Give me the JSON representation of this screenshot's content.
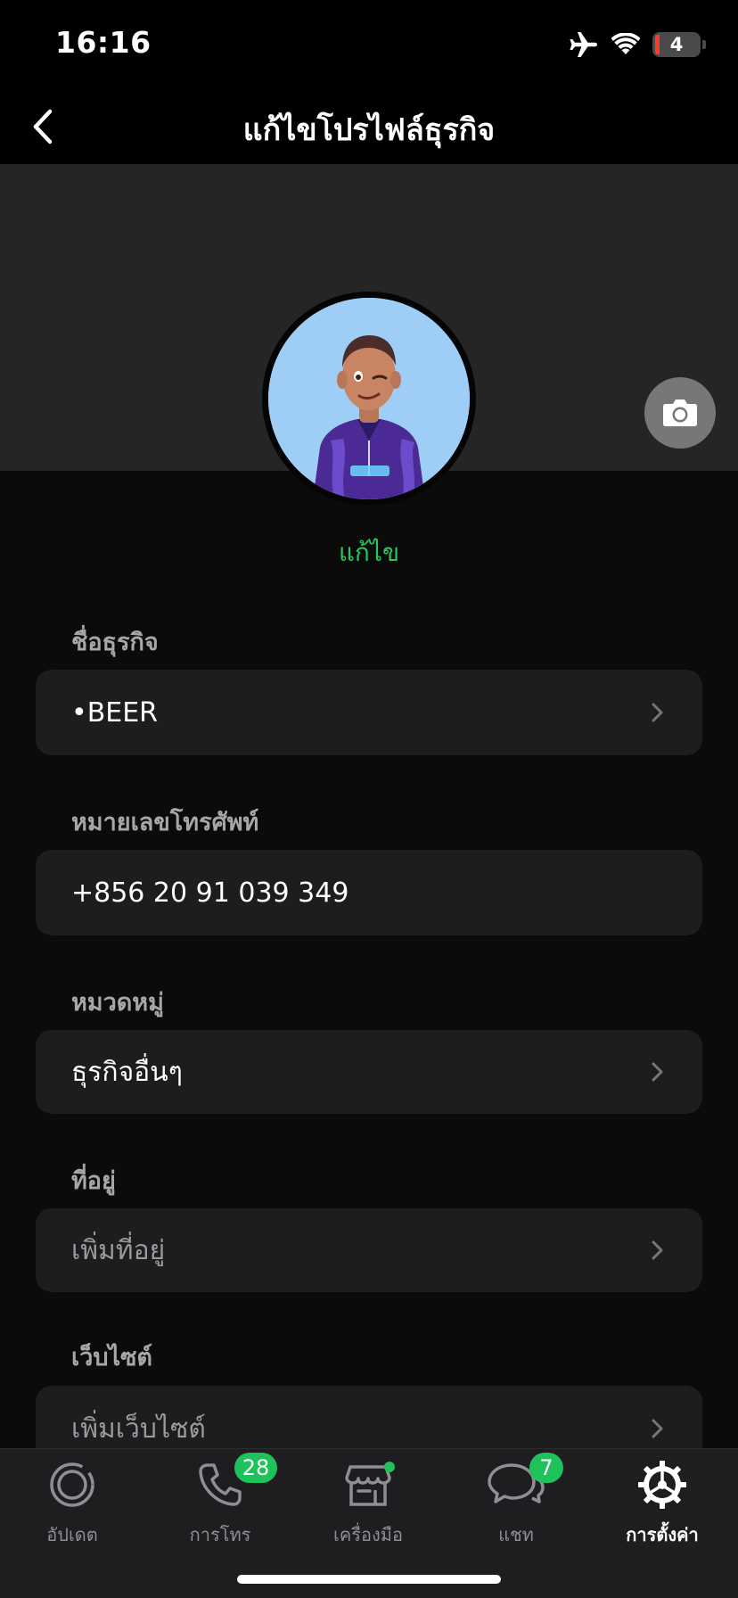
{
  "status_bar": {
    "time": "16:16",
    "battery": "4"
  },
  "header": {
    "title": "แก้ไขโปรไฟล์ธุรกิจ"
  },
  "profile": {
    "edit_label": "แก้ไข"
  },
  "fields": [
    {
      "label": "ชื่อธุรกิจ",
      "value": "•BEER",
      "placeholder": false,
      "chevron": true
    },
    {
      "label": "หมายเลขโทรศัพท์",
      "value": "+856 20 91 039 349",
      "placeholder": false,
      "chevron": false
    },
    {
      "label": "หมวดหมู่",
      "value": "ธุรกิจอื่นๆ",
      "placeholder": false,
      "chevron": true
    },
    {
      "label": "ที่อยู่",
      "value": "เพิ่มที่อยู่",
      "placeholder": true,
      "chevron": true
    },
    {
      "label": "เว็บไซต์",
      "value": "เพิ่มเว็บไซต์",
      "placeholder": true,
      "chevron": true
    }
  ],
  "tabs": [
    {
      "label": "อัปเดต",
      "icon": "updates-icon"
    },
    {
      "label": "การโทร",
      "icon": "phone-icon",
      "badge": "28"
    },
    {
      "label": "เครื่องมือ",
      "icon": "store-tools-icon",
      "dot": true
    },
    {
      "label": "แชท",
      "icon": "chat-bubbles-icon",
      "badge": "7"
    },
    {
      "label": "การตั้งค่า",
      "icon": "gear-icon",
      "active": true
    }
  ],
  "colors": {
    "accent": "#2cc35b",
    "badge": "#1fc15a",
    "background": "#0b0b0c",
    "row": "#1c1d1f",
    "cover": "#252525"
  }
}
